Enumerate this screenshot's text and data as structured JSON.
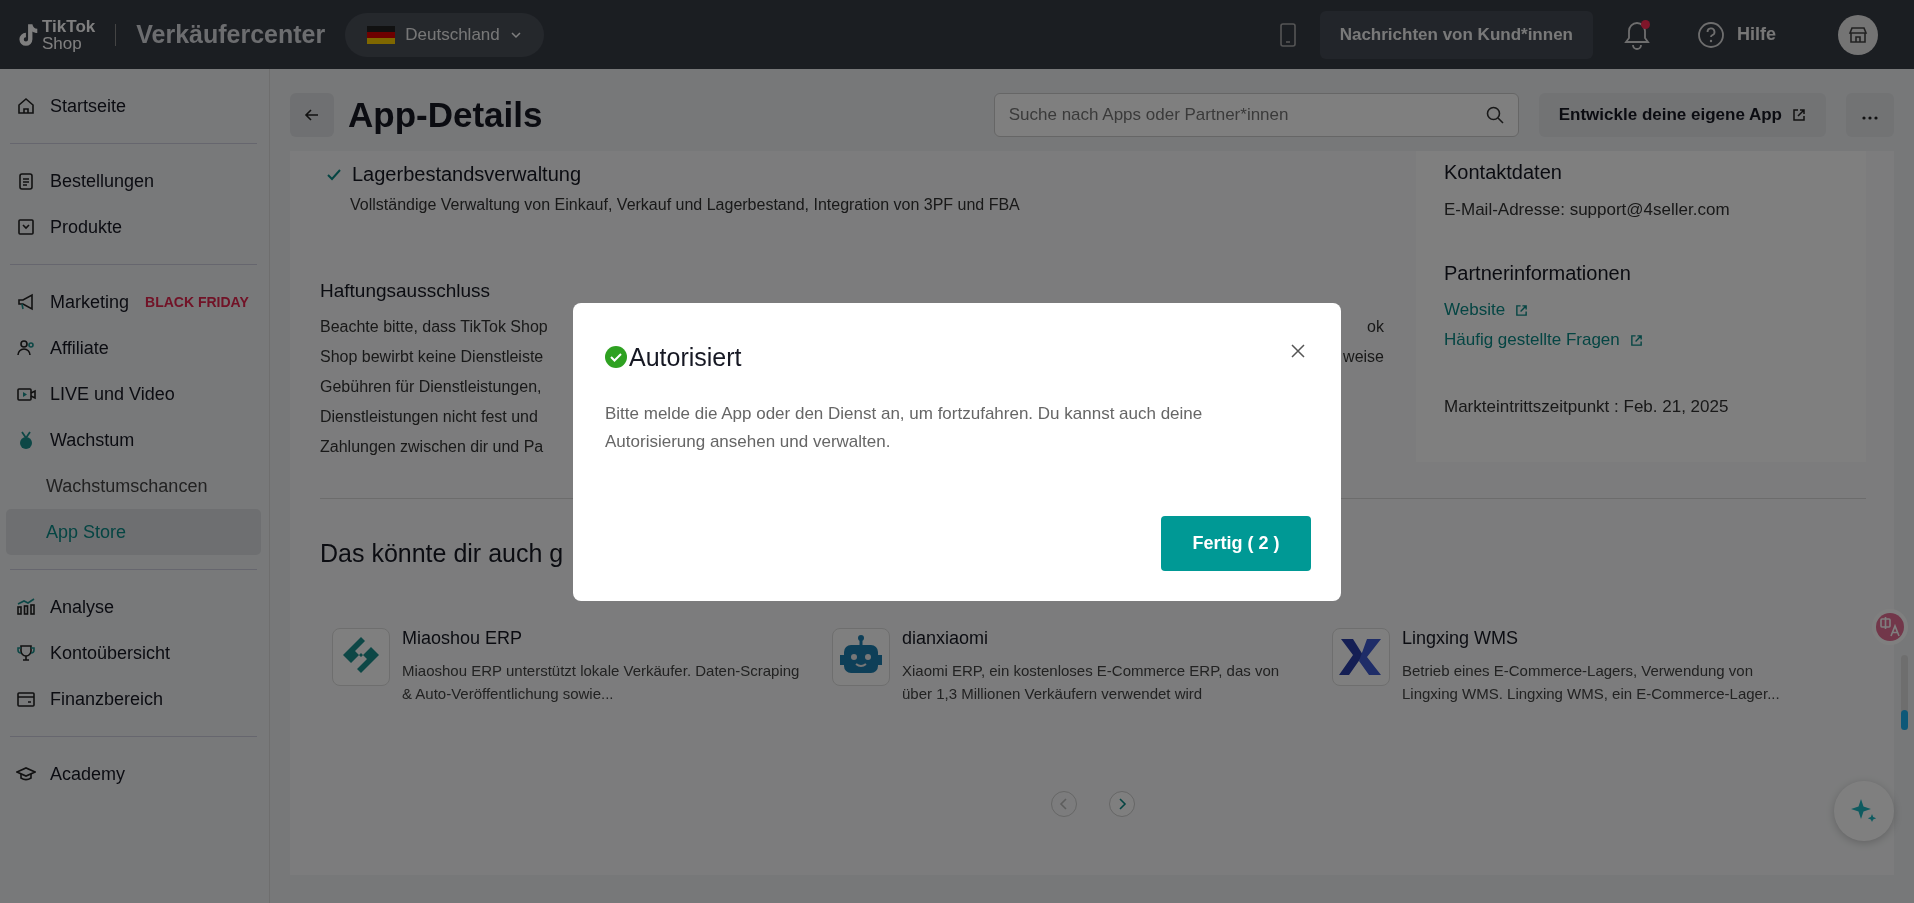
{
  "topbar": {
    "logo_top": "TikTok",
    "logo_bottom": "Shop",
    "title": "Verkäufercenter",
    "region": "Deutschland",
    "messages": "Nachrichten von Kund*innen",
    "notification_unread": true,
    "help": "Hilfe"
  },
  "sidebar": {
    "groups": [
      [
        {
          "label": "Startseite",
          "selected": false
        }
      ],
      [
        {
          "label": "Bestellungen",
          "selected": false
        },
        {
          "label": "Produkte",
          "selected": false
        }
      ],
      [
        {
          "label": "Marketing",
          "badge": "BLACK FRIDAY",
          "selected": false
        },
        {
          "label": "Affiliate",
          "selected": false
        },
        {
          "label": "LIVE und Video",
          "selected": false
        },
        {
          "label": "Wachstum",
          "selected": false,
          "children": [
            {
              "label": "Wachstumschancen",
              "selected": false
            },
            {
              "label": "App Store",
              "selected": true
            }
          ]
        }
      ],
      [
        {
          "label": "Analyse",
          "selected": false
        },
        {
          "label": "Kontoübersicht",
          "selected": false
        },
        {
          "label": "Finanzbereich",
          "selected": false
        }
      ],
      [
        {
          "label": "Academy",
          "selected": false
        }
      ]
    ]
  },
  "header": {
    "title": "App-Details",
    "search": {
      "placeholder": "Suche nach Apps oder Partner*innen"
    },
    "develop_button": "Entwickle deine eigene App"
  },
  "feature": {
    "title": "Lagerbestandsverwaltung",
    "description": "Vollständige Verwaltung von Einkauf, Verkauf und Lagerbestand, Integration von 3PF und FBA"
  },
  "disclaimer": {
    "title": "Haftungsausschluss",
    "lines": [
      {
        "left": "Beachte bitte, dass TikTok Shop",
        "right": "ok"
      },
      {
        "left": "Shop bewirbt keine Dienstleiste",
        "right": "weise"
      },
      {
        "left": "Gebühren für Dienstleistungen,"
      },
      {
        "left": "Dienstleistungen nicht fest und"
      },
      {
        "left": "Zahlungen zwischen dir und Pa"
      }
    ]
  },
  "contact": {
    "title": "Kontaktdaten",
    "email": "E-Mail-Adresse: support@4seller.com"
  },
  "partner": {
    "title": "Partnerinformationen",
    "links": [
      "Website",
      "Häufig gestellte Fragen"
    ],
    "market_entry": "Markteintrittszeitpunkt : Feb. 21, 2025"
  },
  "recommendations": {
    "title": "Das könnte dir auch g",
    "apps": [
      {
        "name": "Miaoshou ERP",
        "description": "Miaoshou ERP unterstützt lokale Verkäufer. Daten-Scraping & Auto-Veröffentlichung sowie..."
      },
      {
        "name": "dianxiaomi",
        "description": "Xiaomi ERP, ein kostenloses E-Commerce ERP, das von über 1,3 Millionen Verkäufern verwendet wird"
      },
      {
        "name": "Lingxing WMS",
        "description": "Betrieb eines E-Commerce-Lagers, Verwendung von Lingxing WMS. Lingxing WMS, ein E-Commerce-Lager..."
      }
    ],
    "prev_disabled": true
  },
  "modal": {
    "title": "Autorisiert",
    "message": "Bitte melde die App oder den Dienst an, um fortzufahren. Du kannst auch deine Autorisierung ansehen und verwalten.",
    "button": "Fertig ( 2 )"
  }
}
